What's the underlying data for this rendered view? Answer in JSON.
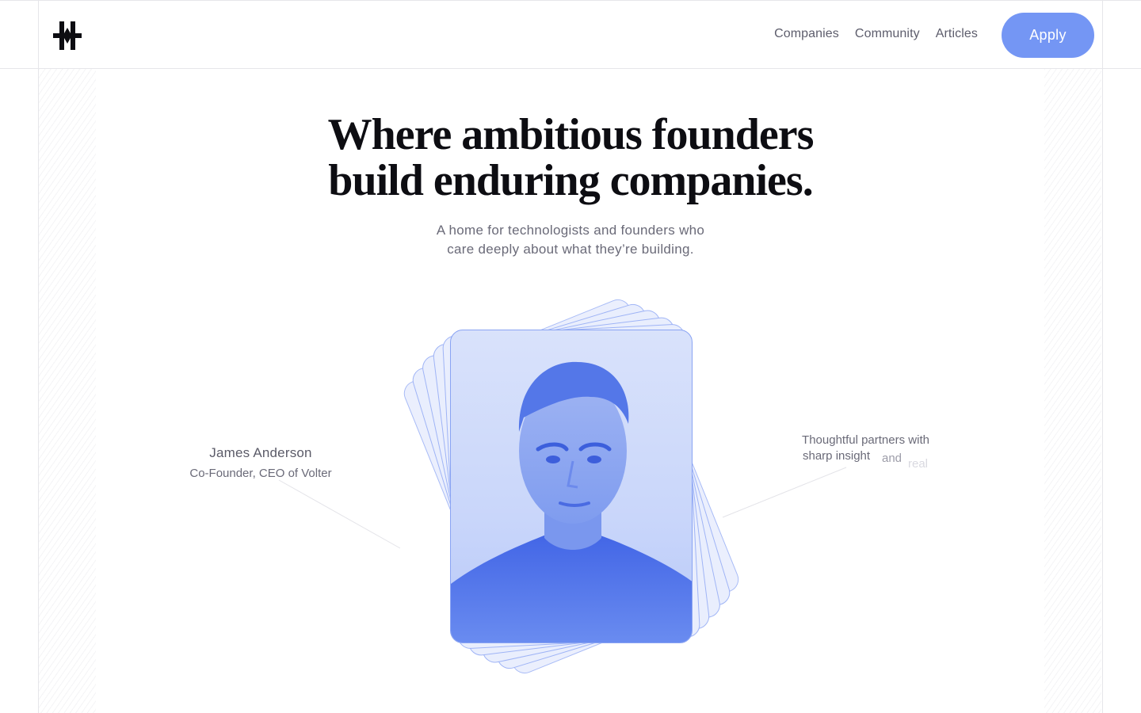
{
  "header": {
    "logo_icon": "asterisk-hash-logo-icon",
    "nav": [
      {
        "label": "Companies"
      },
      {
        "label": "Community"
      },
      {
        "label": "Articles"
      }
    ],
    "apply_label": "Apply"
  },
  "hero": {
    "headline_line1": "Where ambitious founders",
    "headline_line2": "build enduring companies.",
    "subhead_line1": "A home for technologists and founders who",
    "subhead_line2": "care deeply about what they’re building."
  },
  "feature": {
    "person_name": "James Anderson",
    "person_role": "Co-Founder, CEO of Volter",
    "quote_line1": "Thoughtful partners with",
    "quote_line2": "sharp insight",
    "quote_word_and": "and",
    "quote_word_real": "real"
  },
  "colors": {
    "accent": "#7496f4",
    "card_border": "#8aa4f3",
    "card_fill": "#e9eefd",
    "portrait_blue": "#4d70ea"
  }
}
